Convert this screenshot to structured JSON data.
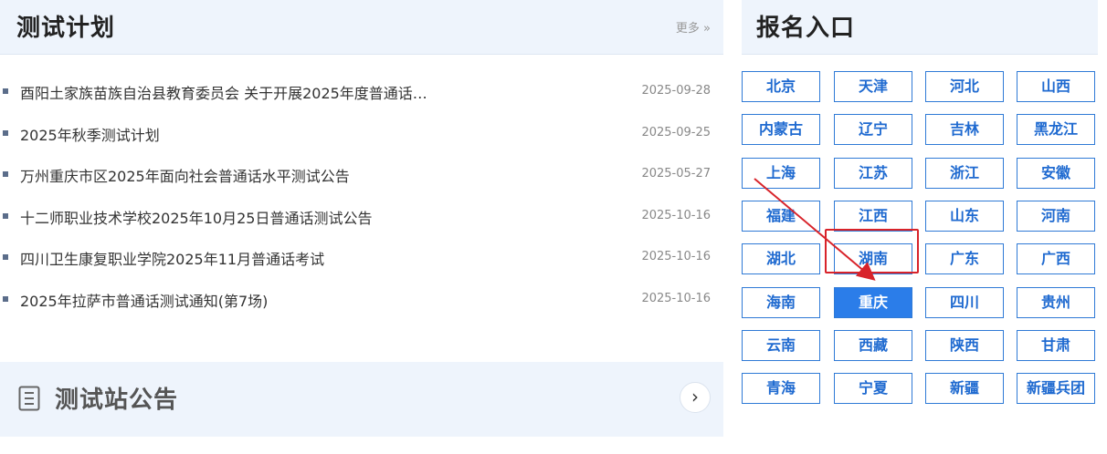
{
  "test_plan": {
    "title": "测试计划",
    "more": "更多 »",
    "items": [
      {
        "title": "酉阳土家族苗族自治县教育委员会 关于开展2025年度普通话…",
        "date": "2025-09-28"
      },
      {
        "title": "2025年秋季测试计划",
        "date": "2025-09-25"
      },
      {
        "title": "万州重庆市区2025年面向社会普通话水平测试公告",
        "date": "2025-05-27"
      },
      {
        "title": "十二师职业技术学校2025年10月25日普通话测试公告",
        "date": "2025-10-16"
      },
      {
        "title": "四川卫生康复职业学院2025年11月普通话考试",
        "date": "2025-10-16"
      },
      {
        "title": "2025年拉萨市普通话测试通知(第7场)",
        "date": "2025-10-16"
      }
    ]
  },
  "station_notice": {
    "title": "测试站公告",
    "arrow": "›"
  },
  "registration": {
    "title": "报名入口",
    "provinces": [
      "北京",
      "天津",
      "河北",
      "山西",
      "内蒙古",
      "辽宁",
      "吉林",
      "黑龙江",
      "上海",
      "江苏",
      "浙江",
      "安徽",
      "福建",
      "江西",
      "山东",
      "河南",
      "湖北",
      "湖南",
      "广东",
      "广西",
      "海南",
      "重庆",
      "四川",
      "贵州",
      "云南",
      "西藏",
      "陕西",
      "甘肃",
      "青海",
      "宁夏",
      "新疆",
      "新疆兵团"
    ],
    "active": "重庆"
  },
  "colors": {
    "accent": "#2b7de9",
    "highlight": "#d8232a",
    "panel_bg": "#eef4fc"
  }
}
